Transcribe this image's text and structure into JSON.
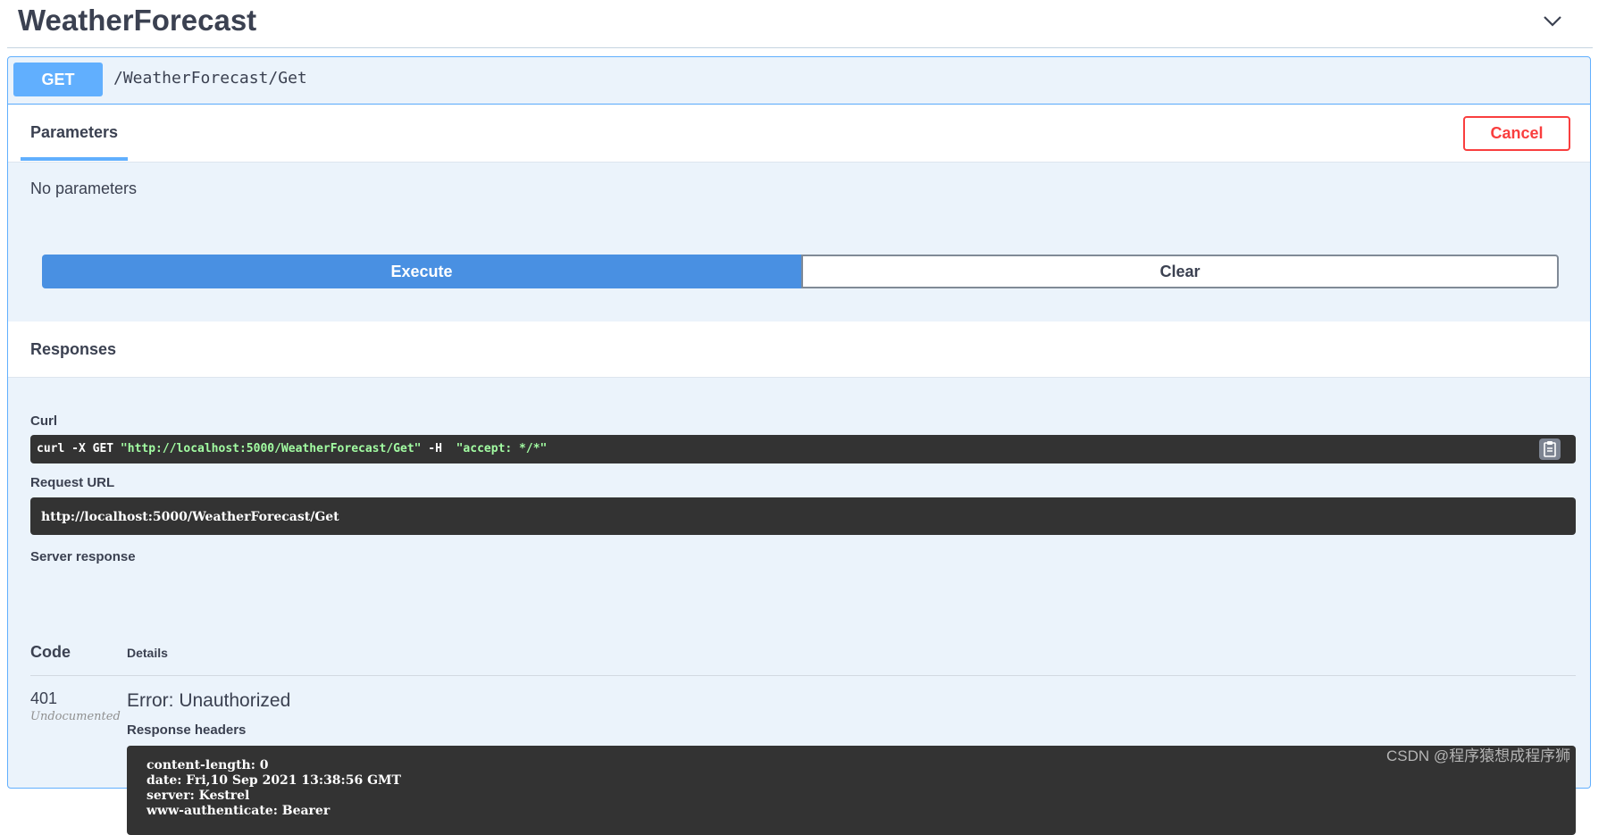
{
  "header": {
    "title": "WeatherForecast",
    "collapse_icon": "chevron-down-icon"
  },
  "operation": {
    "method": "GET",
    "path": "/WeatherForecast/Get",
    "method_color": "#61affe"
  },
  "parameters": {
    "tab_label": "Parameters",
    "cancel_label": "Cancel",
    "empty_text": "No parameters"
  },
  "actions": {
    "execute_label": "Execute",
    "clear_label": "Clear"
  },
  "responses": {
    "title": "Responses",
    "curl_label": "Curl",
    "curl": {
      "cmd": "curl -X GET ",
      "url": "\"http://localhost:5000/WeatherForecast/Get\"",
      "flag": " -H  ",
      "header": "\"accept: */*\""
    },
    "copy_icon": "clipboard-icon",
    "request_url_label": "Request URL",
    "request_url": "http://localhost:5000/WeatherForecast/Get",
    "server_response_label": "Server response",
    "code_header": "Code",
    "details_header": "Details",
    "code": "401",
    "code_note": "Undocumented",
    "error_text": "Error: Unauthorized",
    "response_headers_label": "Response headers",
    "response_headers": [
      "content-length: 0",
      "date: Fri,10 Sep 2021 13:38:56 GMT",
      "server: Kestrel",
      "www-authenticate: Bearer"
    ]
  },
  "watermark": "CSDN @程序猿想成程序狮"
}
